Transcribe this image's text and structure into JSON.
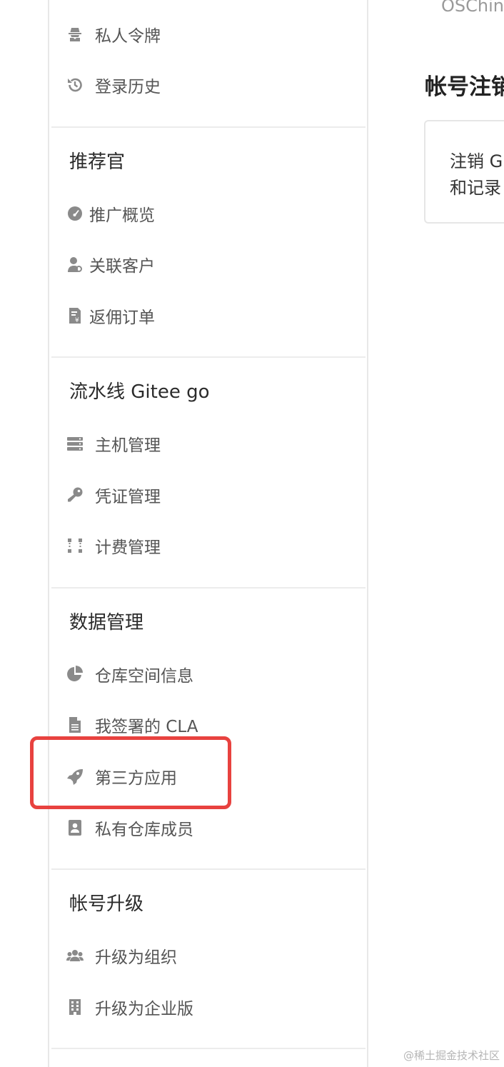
{
  "sidebar": {
    "security_items": [
      {
        "label": "私人令牌",
        "icon": "spy-icon"
      },
      {
        "label": "登录历史",
        "icon": "history-icon"
      }
    ],
    "sections": [
      {
        "heading": "推荐官",
        "items": [
          {
            "label": "推广概览",
            "icon": "dashboard-icon"
          },
          {
            "label": "关联客户",
            "icon": "user-link-icon"
          },
          {
            "label": "返佣订单",
            "icon": "invoice-icon"
          }
        ]
      },
      {
        "heading": "流水线 Gitee go",
        "items": [
          {
            "label": "主机管理",
            "icon": "server-icon"
          },
          {
            "label": "凭证管理",
            "icon": "key-icon"
          },
          {
            "label": "计费管理",
            "icon": "nodes-icon"
          }
        ]
      },
      {
        "heading": "数据管理",
        "items": [
          {
            "label": "仓库空间信息",
            "icon": "pie-chart-icon"
          },
          {
            "label": "我签署的 CLA",
            "icon": "document-icon"
          },
          {
            "label": "第三方应用",
            "icon": "rocket-icon",
            "highlighted": true
          },
          {
            "label": "私有仓库成员",
            "icon": "contact-card-icon"
          }
        ]
      },
      {
        "heading": "帐号升级",
        "items": [
          {
            "label": "升级为组织",
            "icon": "users-icon"
          },
          {
            "label": "升级为企业版",
            "icon": "building-icon"
          }
        ]
      }
    ]
  },
  "main": {
    "top_text": "OSChin",
    "title": "帐号注销",
    "card_lines": [
      "注销 G",
      "和记录"
    ]
  },
  "watermark": "@稀土掘金技术社区",
  "colors": {
    "highlight": "#e8423f",
    "icon": "#8a8a8a",
    "divider": "#ececec"
  }
}
